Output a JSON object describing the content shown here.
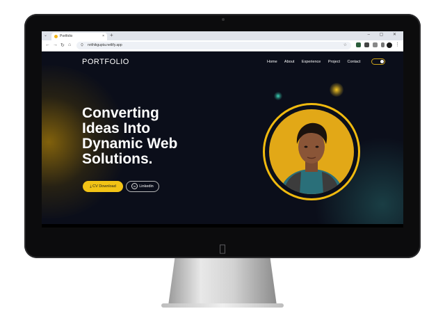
{
  "browser": {
    "tab_title": "Portfolio",
    "tab_close": "×",
    "new_tab": "+",
    "url": "nrithikgupta.netlify.app",
    "window_controls": "– ▢ ✕"
  },
  "site": {
    "logo": "PORTFOLIO",
    "nav": [
      "Home",
      "About",
      "Experience",
      "Project",
      "Contact"
    ],
    "hero_title_lines": [
      "Converting",
      "Ideas Into",
      "Dynamic Web",
      "Solutions."
    ],
    "buttons": {
      "cv": "CV Download",
      "linkedin": "Linkedin"
    }
  },
  "icons": {
    "cv": "download-icon",
    "linkedin": "linkedin-icon",
    "theme": "theme-toggle-icon",
    "apple": "apple-logo"
  },
  "colors": {
    "accent": "#f3c316",
    "background": "#0b0e1a"
  }
}
